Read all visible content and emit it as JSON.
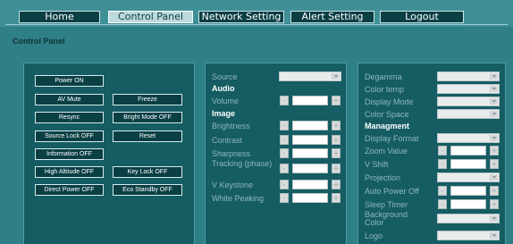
{
  "nav": {
    "home": "Home",
    "control_panel": "Control Panel",
    "network_setting": "Network Setting",
    "alert_setting": "Alert Setting",
    "logout": "Logout"
  },
  "page_title": "Control Panel",
  "buttons": {
    "power_on": "Power ON",
    "av_mute": "AV Mute",
    "freeze": "Freeze",
    "resync": "Resync",
    "bright_mode_off": "Bright Mode OFF",
    "source_lock_off": "Source Lock OFF",
    "reset": "Reset",
    "information_off": "Information OFF",
    "high_altitude_off": "High Altitude OFF",
    "key_lock_off": "Key Lock OFF",
    "direct_power_off": "Direct Power OFF",
    "eco_standby_off": "Eco Standby OFF"
  },
  "middle": {
    "source": "Source",
    "audio": "Audio",
    "volume": "Volume",
    "image": "Image",
    "brightness": "Brightness",
    "contrast": "Contrast",
    "sharpness": "Sharpness",
    "tracking": "Tracking (phase)",
    "v_keystone": "V Keystone",
    "white_peaking": "White Peaking"
  },
  "right": {
    "degamma": "Degamma",
    "color_temp": "Color temp",
    "display_mode": "Display Mode",
    "color_space": "Color Space",
    "managment": "Managment",
    "display_format": "Display Format",
    "zoom_value": "Zoom Value",
    "v_shift": "V Shift",
    "projection": "Projection",
    "auto_power_off": "Auto Power Off",
    "sleep_timer": "Sleep Timer",
    "background_color": "Background Color",
    "logo": "Logo"
  },
  "step": {
    "minus": "-",
    "plus": "+"
  }
}
